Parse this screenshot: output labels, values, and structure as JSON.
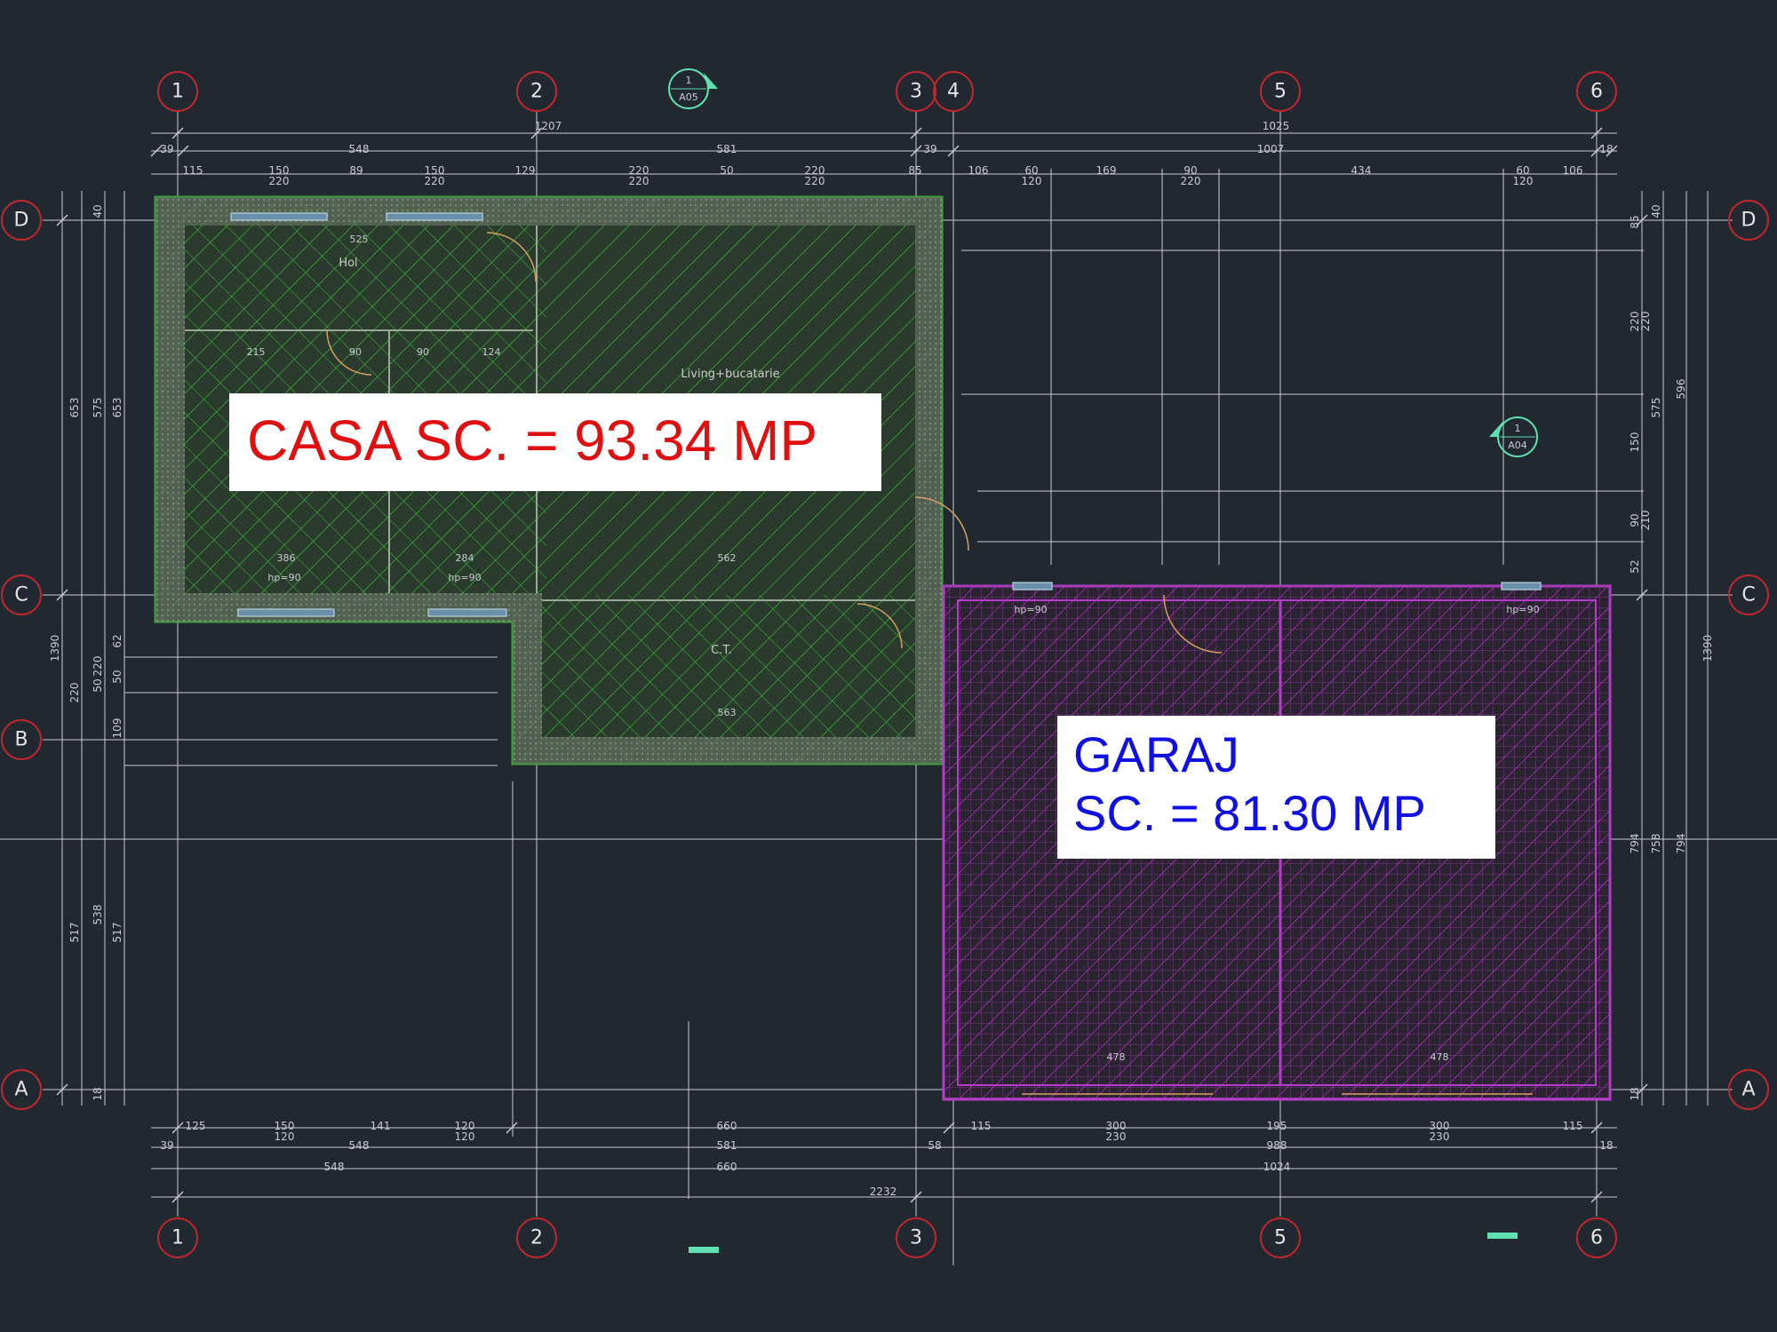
{
  "colors": {
    "background": "#212830",
    "grid_line": "#c9ccd0",
    "bubble": "#c0272d",
    "casa_outline": "#3fa23a",
    "casa_hatch": "#3fbf3a",
    "garaj_outline": "#b43cc8",
    "garaj_hatch": "#c030d0",
    "casa_label": "#e01010",
    "garaj_label": "#1010e0",
    "section_marker": "#5fe0b0"
  },
  "grid": {
    "vertical_axes": [
      "1",
      "2",
      "3",
      "4",
      "5",
      "6"
    ],
    "horizontal_axes": [
      "D",
      "C",
      "B",
      "A"
    ]
  },
  "labels": {
    "casa": "CASA SC. = 93.34 MP",
    "garaj_line1": "GARAJ",
    "garaj_line2": "SC. = 81.30 MP"
  },
  "rooms": {
    "hol": "Hol",
    "living": "Living+bucatarie",
    "ct": "C.T."
  },
  "section_markers": [
    {
      "number": "1",
      "sheet": "A05"
    },
    {
      "number": "1",
      "sheet": "A04"
    }
  ],
  "dimensions": {
    "top_total": "1207",
    "top_total_right": "1025",
    "top_row1": [
      "39",
      "548",
      "581",
      "39",
      "1007",
      "18"
    ],
    "top_row2": [
      "115",
      "150",
      "89",
      "150",
      "129",
      "220",
      "50",
      "220",
      "85",
      "106",
      "60",
      "169",
      "90",
      "434",
      "60",
      "106"
    ],
    "top_row2_sub": [
      "220",
      "220",
      "220",
      "220",
      "120",
      "220",
      "120"
    ],
    "bottom_row1": [
      "125",
      "150",
      "141",
      "120",
      "660",
      "115",
      "300",
      "195",
      "300",
      "115"
    ],
    "bottom_row1_sub": [
      "120",
      "120",
      "230",
      "230"
    ],
    "bottom_row2": [
      "39",
      "548",
      "581",
      "58",
      "988",
      "18"
    ],
    "bottom_row3": [
      "548",
      "660",
      "1024"
    ],
    "bottom_total": "2232",
    "room_dims": [
      "525",
      "215",
      "90",
      "90",
      "124",
      "386",
      "284",
      "562",
      "563",
      "478",
      "478"
    ],
    "hp_labels": [
      "hp=90",
      "hp=90",
      "hp=90",
      "hp=90"
    ],
    "left_vertical": [
      "653",
      "575",
      "653",
      "1390",
      "220",
      "220",
      "62",
      "50",
      "50",
      "109",
      "517",
      "538",
      "517",
      "18",
      "40"
    ],
    "right_vertical": [
      "85",
      "220",
      "220",
      "575",
      "596",
      "150",
      "90",
      "210",
      "52",
      "1390",
      "794",
      "758",
      "794",
      "40",
      "18"
    ]
  }
}
